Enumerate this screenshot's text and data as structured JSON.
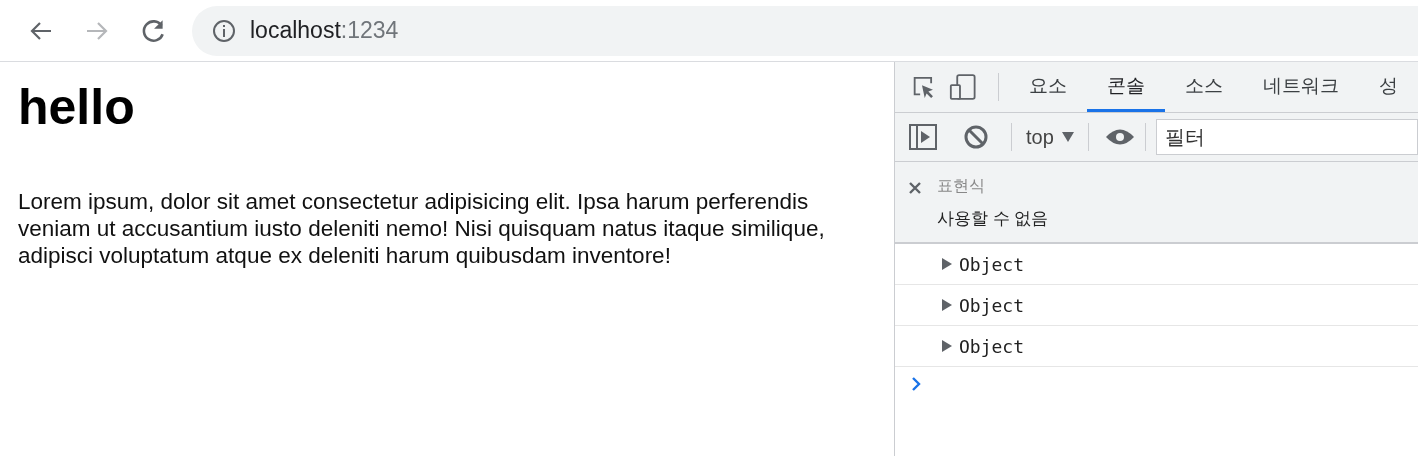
{
  "browser": {
    "back": {
      "disabled": false
    },
    "forward": {
      "disabled": true
    },
    "address": {
      "host": "localhost",
      "port": ":1234"
    }
  },
  "page": {
    "heading": "hello",
    "paragraph": "Lorem ipsum, dolor sit amet consectetur adipisicing elit. Ipsa harum perferendis veniam ut accusantium iusto deleniti nemo! Nisi quisquam natus itaque similique, adipisci voluptatum atque ex deleniti harum quibusdam inventore!"
  },
  "devtools": {
    "tabs": [
      {
        "label": "요소",
        "selected": false
      },
      {
        "label": "콘솔",
        "selected": true
      },
      {
        "label": "소스",
        "selected": false
      },
      {
        "label": "네트워크",
        "selected": false
      },
      {
        "label": "성",
        "selected": false
      }
    ],
    "context": "top",
    "filter": {
      "placeholder": "필터"
    },
    "watch": {
      "label": "표현식",
      "value": "사용할 수 없음"
    },
    "messages": [
      {
        "text": "Object",
        "expanded": false
      },
      {
        "text": "Object",
        "expanded": false
      },
      {
        "text": "Object",
        "expanded": false
      }
    ]
  }
}
